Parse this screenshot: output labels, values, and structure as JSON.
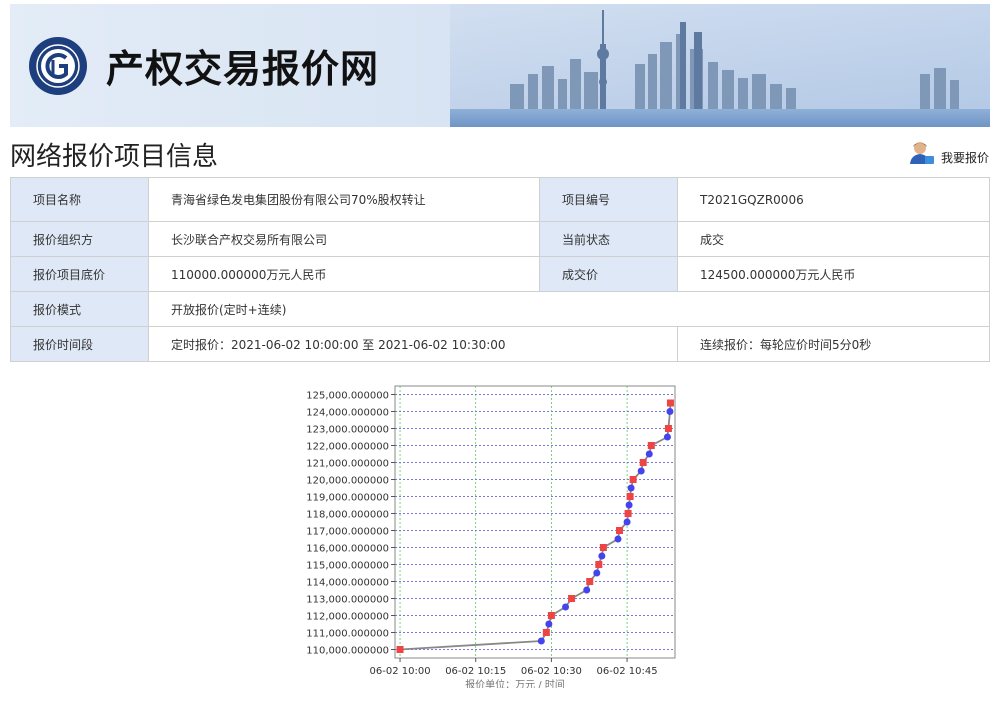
{
  "header": {
    "site_title": "产权交易报价网"
  },
  "page_title": "网络报价项目信息",
  "bid_link": "我要报价",
  "info": {
    "name_label": "项目名称",
    "name_value": "青海省绿色发电集团股份有限公司70%股权转让",
    "code_label": "项目编号",
    "code_value": "T2021GQZR0006",
    "organizer_label": "报价组织方",
    "organizer_value": "长沙联合产权交易所有限公司",
    "status_label": "当前状态",
    "status_value": "成交",
    "base_label": "报价项目底价",
    "base_value": "110000.000000万元人民币",
    "deal_label": "成交价",
    "deal_value": "124500.000000万元人民币",
    "mode_label": "报价模式",
    "mode_value": "开放报价(定时+连续)",
    "period_label": "报价时间段",
    "period_value": "定时报价：2021-06-02 10:00:00 至 2021-06-02 10:30:00",
    "continuous_value": "连续报价：每轮应价时间5分0秒"
  },
  "chart_data": {
    "type": "line",
    "xlabel": "报价单位：万元 / 时间",
    "x_ticks": [
      "06-02 10:00",
      "06-02 10:15",
      "06-02 10:30",
      "06-02 10:45"
    ],
    "x_tick_minutes": [
      0,
      15,
      30,
      45
    ],
    "xlim_minutes": [
      -1,
      54.5
    ],
    "ylim": [
      109500,
      125500
    ],
    "y_ticks": [
      110000,
      111000,
      112000,
      113000,
      114000,
      115000,
      116000,
      117000,
      118000,
      119000,
      120000,
      121000,
      122000,
      123000,
      124000,
      125000
    ],
    "y_tick_labels": [
      "110,000.000000",
      "111,000.000000",
      "112,000.000000",
      "113,000.000000",
      "114,000.000000",
      "115,000.000000",
      "116,000.000000",
      "117,000.000000",
      "118,000.000000",
      "119,000.000000",
      "120,000.000000",
      "121,000.000000",
      "122,000.000000",
      "123,000.000000",
      "124,000.000000",
      "125,000.000000"
    ],
    "grid": true,
    "colors": {
      "series_a": "#ee4444",
      "series_b": "#4444ee",
      "line": "#888888"
    },
    "points": [
      {
        "t": 0.0,
        "v": 110000,
        "s": "a"
      },
      {
        "t": 28.0,
        "v": 110500,
        "s": "b"
      },
      {
        "t": 29.0,
        "v": 111000,
        "s": "a"
      },
      {
        "t": 29.5,
        "v": 111500,
        "s": "b"
      },
      {
        "t": 30.0,
        "v": 112000,
        "s": "a"
      },
      {
        "t": 32.8,
        "v": 112500,
        "s": "b"
      },
      {
        "t": 34.0,
        "v": 113000,
        "s": "a"
      },
      {
        "t": 37.0,
        "v": 113500,
        "s": "b"
      },
      {
        "t": 37.6,
        "v": 114000,
        "s": "a"
      },
      {
        "t": 39.0,
        "v": 114500,
        "s": "b"
      },
      {
        "t": 39.4,
        "v": 115000,
        "s": "a"
      },
      {
        "t": 40.0,
        "v": 115500,
        "s": "b"
      },
      {
        "t": 40.3,
        "v": 116000,
        "s": "a"
      },
      {
        "t": 43.2,
        "v": 116500,
        "s": "b"
      },
      {
        "t": 43.5,
        "v": 117000,
        "s": "a"
      },
      {
        "t": 45.0,
        "v": 117500,
        "s": "b"
      },
      {
        "t": 45.2,
        "v": 118000,
        "s": "a"
      },
      {
        "t": 45.4,
        "v": 118500,
        "s": "b"
      },
      {
        "t": 45.6,
        "v": 119000,
        "s": "a"
      },
      {
        "t": 45.8,
        "v": 119500,
        "s": "b"
      },
      {
        "t": 46.2,
        "v": 120000,
        "s": "a"
      },
      {
        "t": 47.8,
        "v": 120500,
        "s": "b"
      },
      {
        "t": 48.2,
        "v": 121000,
        "s": "a"
      },
      {
        "t": 49.4,
        "v": 121500,
        "s": "b"
      },
      {
        "t": 49.8,
        "v": 122000,
        "s": "a"
      },
      {
        "t": 53.0,
        "v": 122500,
        "s": "b"
      },
      {
        "t": 53.2,
        "v": 123000,
        "s": "a"
      },
      {
        "t": 53.5,
        "v": 124000,
        "s": "b"
      },
      {
        "t": 53.6,
        "v": 124500,
        "s": "a"
      }
    ]
  }
}
